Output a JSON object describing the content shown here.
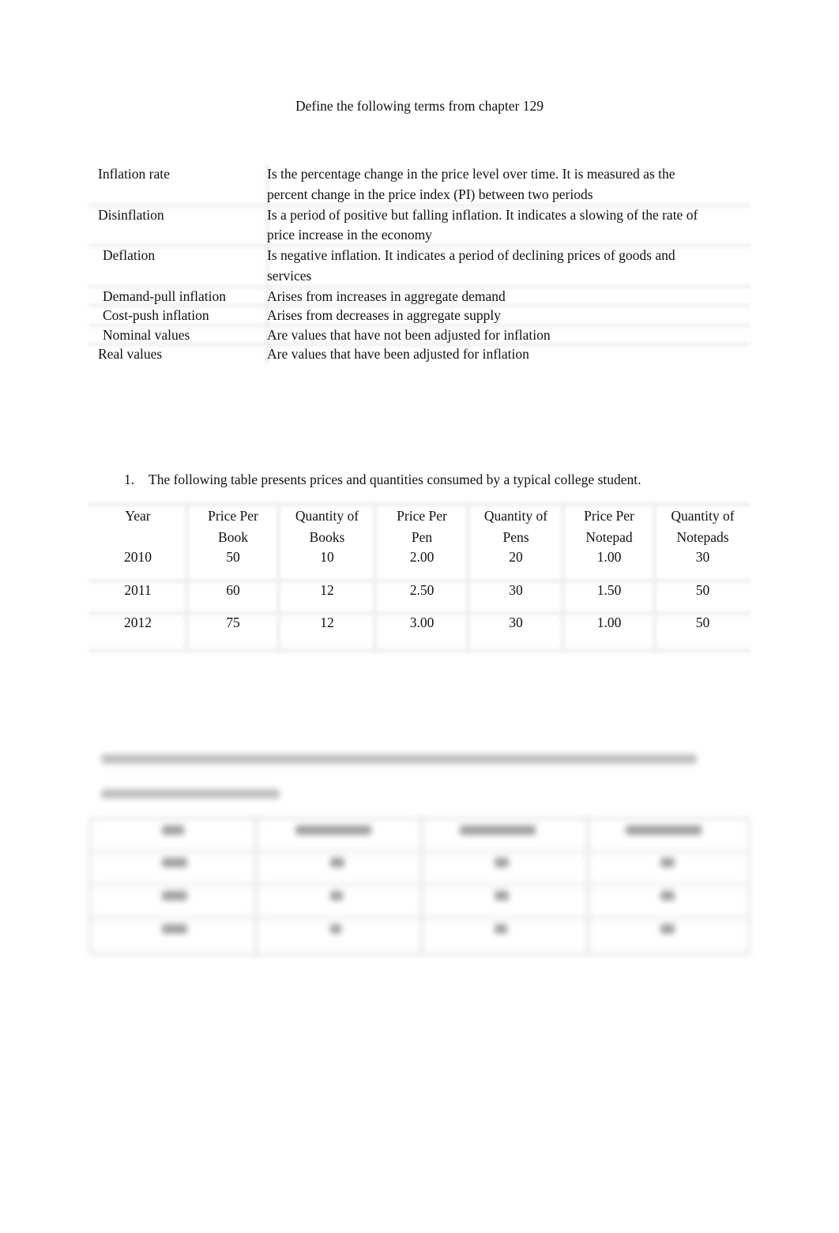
{
  "document": {
    "title": "Define the following terms from chapter 129",
    "terms": [
      {
        "term": "Inflation rate",
        "definition_lines": [
          "Is the percentage change in the price level over time. It is measured as the",
          "percent change in the price index (PI) between two periods"
        ]
      },
      {
        "term": "Disinflation",
        "definition_lines": [
          "Is a period of positive but falling inflation. It indicates a slowing of the rate of",
          "price increase in the economy"
        ]
      },
      {
        "term": "Deflation",
        "definition_lines": [
          "Is negative inflation. It indicates a period of declining prices of goods and",
          "services"
        ]
      },
      {
        "term": "Demand-pull inflation",
        "definition_lines": [
          "Arises from increases in aggregate demand"
        ]
      },
      {
        "term": "Cost-push inflation",
        "definition_lines": [
          "Arises from decreases in aggregate supply"
        ]
      },
      {
        "term": "Nominal values",
        "definition_lines": [
          "Are values that have not been adjusted for inflation"
        ]
      },
      {
        "term": "Real values",
        "definition_lines": [
          "Are values that have been adjusted for inflation"
        ]
      }
    ],
    "question1": {
      "number": "1.",
      "text": "The following table presents prices and quantities consumed by a typical college student."
    },
    "price_table": {
      "headers": [
        [
          "Year",
          ""
        ],
        [
          "Price Per",
          "Book"
        ],
        [
          "Quantity of",
          "Books"
        ],
        [
          "Price Per",
          "Pen"
        ],
        [
          "Quantity of",
          "Pens"
        ],
        [
          "Price Per",
          "Notepad"
        ],
        [
          "Quantity of",
          "Notepads"
        ]
      ],
      "rows": [
        [
          "2010",
          "50",
          "10",
          "2.00",
          "20",
          "1.00",
          "30"
        ],
        [
          "2011",
          "60",
          "12",
          "2.50",
          "30",
          "1.50",
          "50"
        ],
        [
          "2012",
          "75",
          "12",
          "3.00",
          "30",
          "1.00",
          "50"
        ]
      ]
    },
    "blurred_section": {
      "note": "content obscured (blurred) in screenshot",
      "columns": 4,
      "rows": 4
    }
  }
}
